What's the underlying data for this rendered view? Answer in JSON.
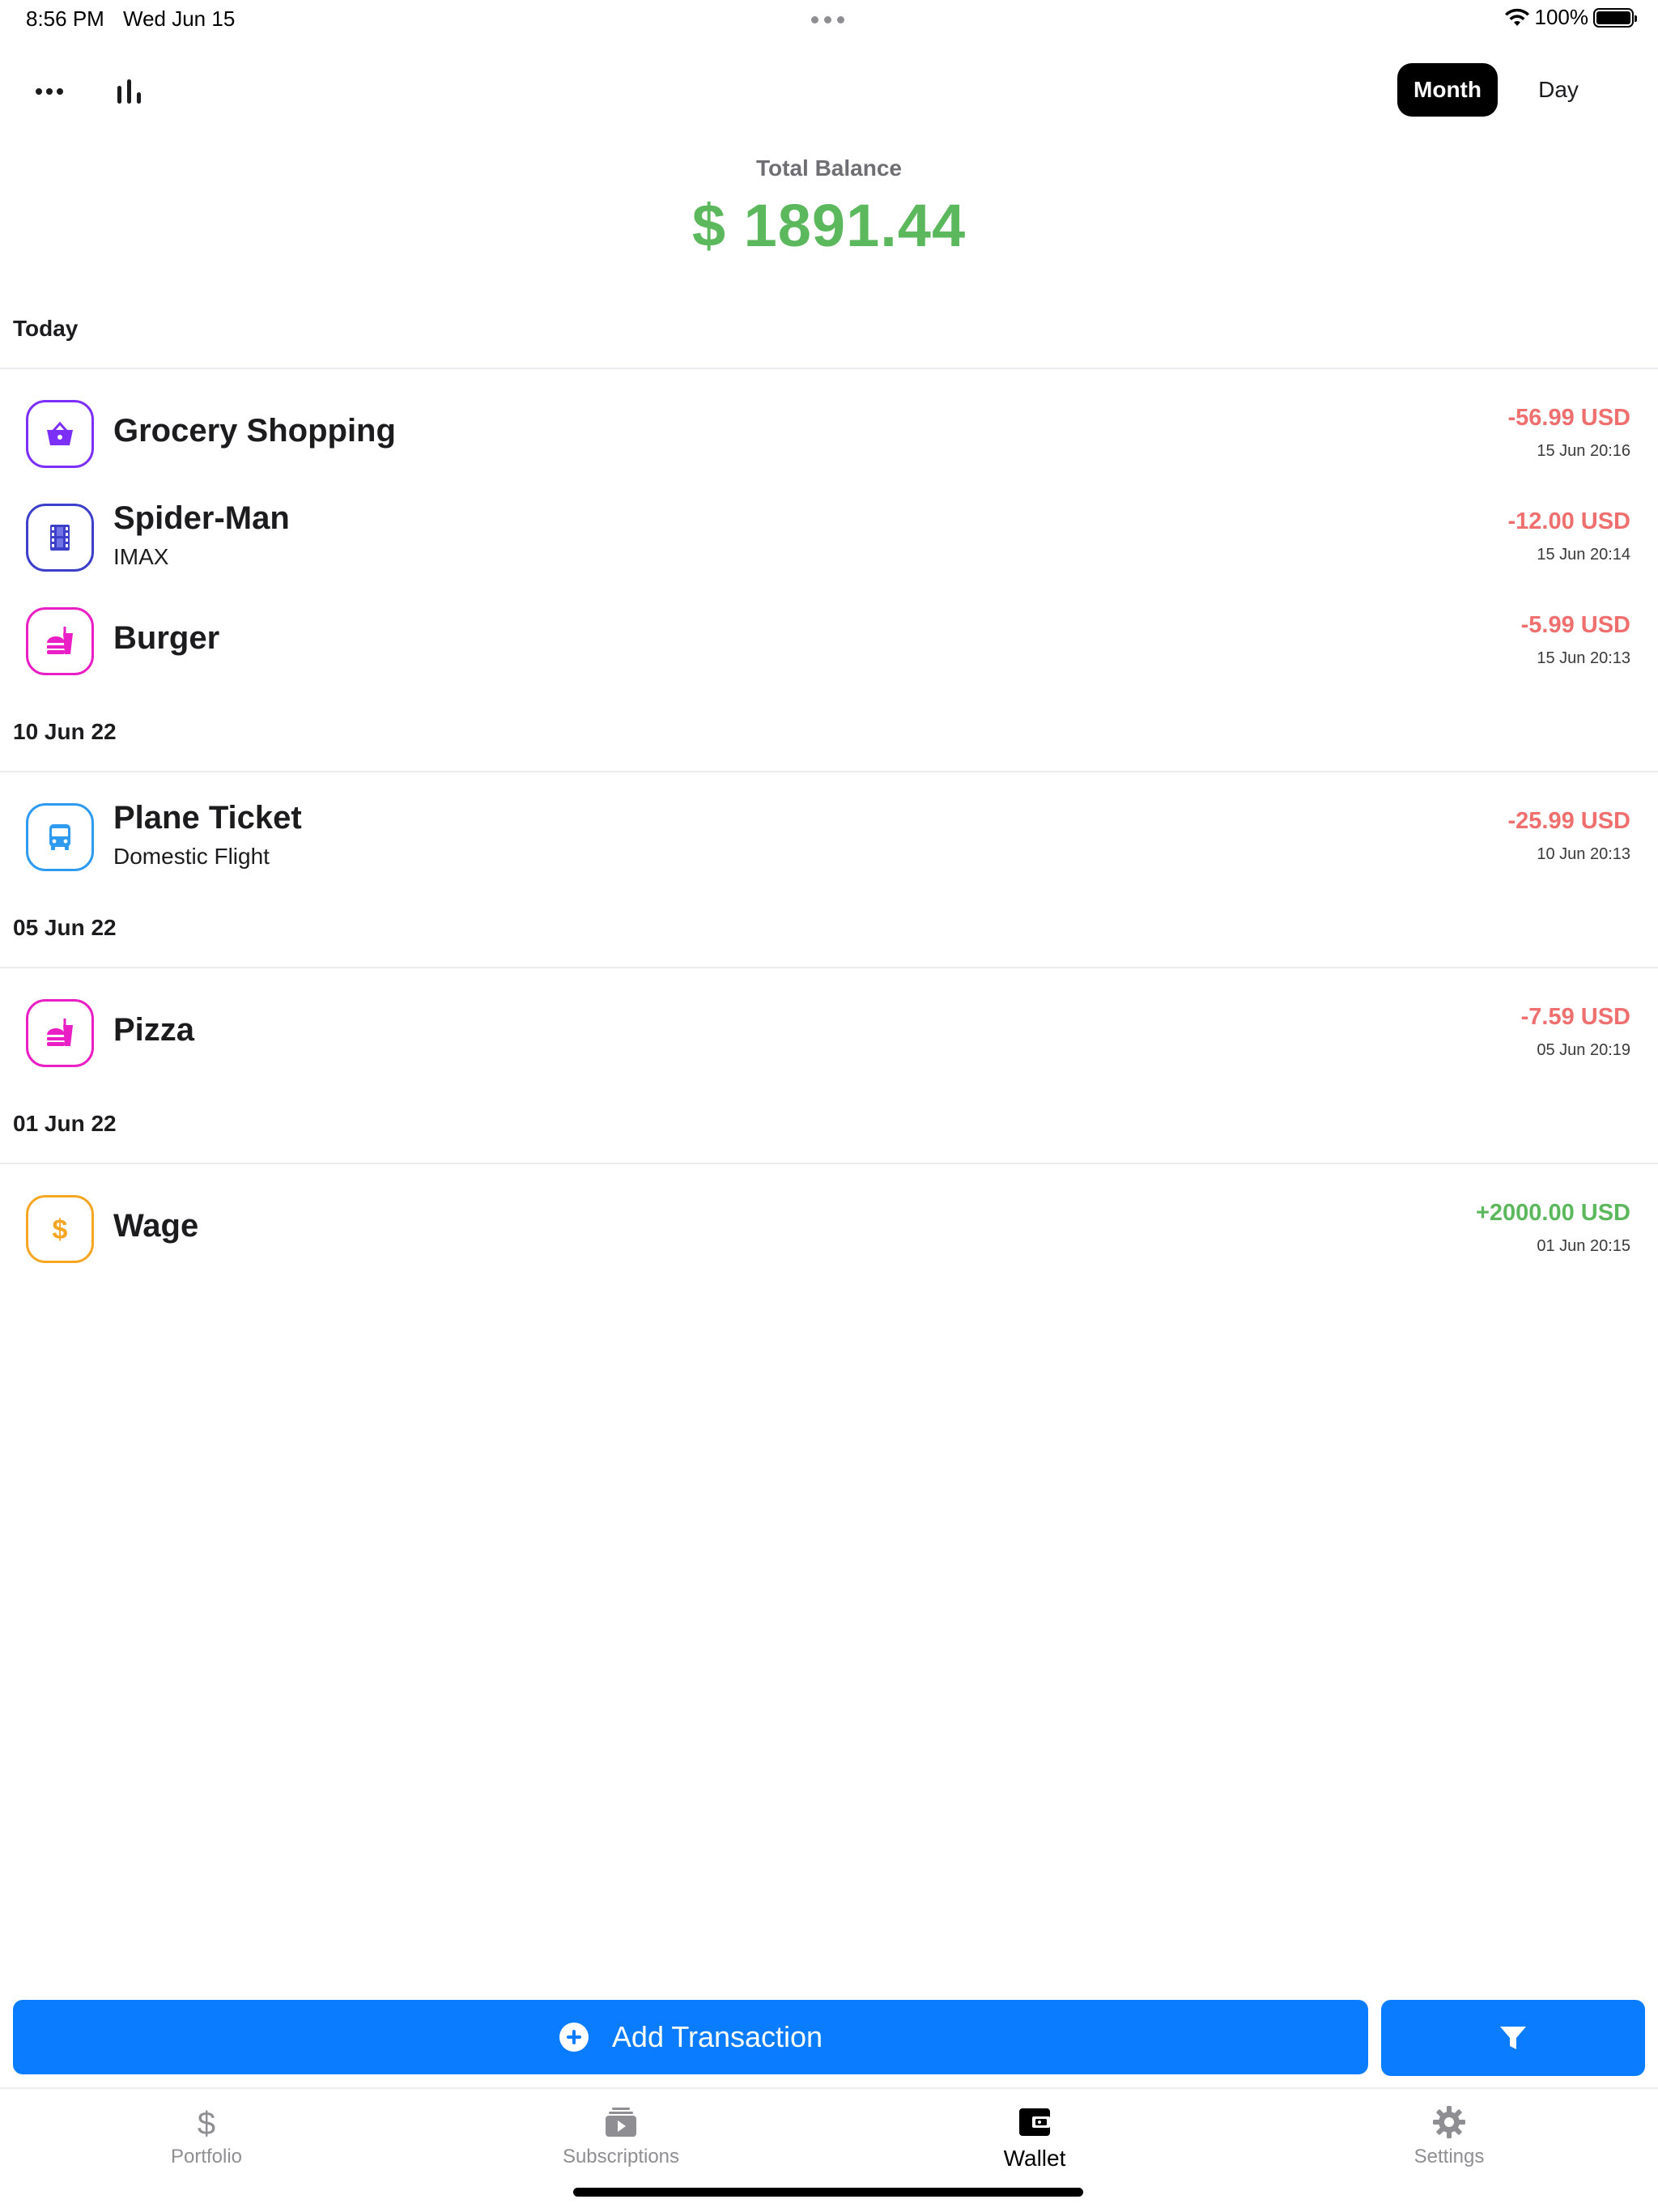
{
  "status_bar": {
    "time": "8:56 PM",
    "date": "Wed Jun 15",
    "battery": "100%"
  },
  "toolbar": {
    "more_icon": "ellipsis-icon",
    "chart_icon": "bar-chart-icon",
    "segments": [
      "Month",
      "Day"
    ],
    "selected_segment": "Month"
  },
  "balance": {
    "label": "Total Balance",
    "value": "$ 1891.44",
    "color": "#5cb85c"
  },
  "sections": [
    {
      "header": "Today",
      "transactions": [
        {
          "title": "Grocery Shopping",
          "subtitle": "",
          "amount": "-56.99 USD",
          "time": "15 Jun 20:16",
          "icon": "basket-icon",
          "icon_color": "#7b2ff7"
        },
        {
          "title": "Spider-Man",
          "subtitle": "IMAX",
          "amount": "-12.00 USD",
          "time": "15 Jun 20:14",
          "icon": "film-icon",
          "icon_color": "#3b3fc9"
        },
        {
          "title": "Burger",
          "subtitle": "",
          "amount": "-5.99 USD",
          "time": "15 Jun 20:13",
          "icon": "fastfood-icon",
          "icon_color": "#e91ec4"
        }
      ]
    },
    {
      "header": "10 Jun 22",
      "transactions": [
        {
          "title": "Plane Ticket",
          "subtitle": "Domestic Flight",
          "amount": "-25.99 USD",
          "time": "10 Jun 20:13",
          "icon": "bus-icon",
          "icon_color": "#2e9bf0"
        }
      ]
    },
    {
      "header": "05 Jun 22",
      "transactions": [
        {
          "title": "Pizza",
          "subtitle": "",
          "amount": "-7.59 USD",
          "time": "05 Jun 20:19",
          "icon": "fastfood-icon",
          "icon_color": "#e91ec4"
        }
      ]
    },
    {
      "header": "01 Jun 22",
      "transactions": [
        {
          "title": "Wage",
          "subtitle": "",
          "amount": "+2000.00 USD",
          "time": "01 Jun 20:15",
          "icon": "dollar-icon",
          "icon_color": "#f5a623"
        }
      ]
    }
  ],
  "colors": {
    "expense": "#ef6f6f",
    "income": "#5cb85c",
    "accent": "#0a7cff"
  },
  "actions": {
    "add_label": "Add Transaction",
    "add_icon": "plus-circle-icon",
    "filter_icon": "filter-icon"
  },
  "tabs": [
    {
      "label": "Portfolio",
      "icon": "dollar-icon",
      "active": false
    },
    {
      "label": "Subscriptions",
      "icon": "subscriptions-icon",
      "active": false
    },
    {
      "label": "Wallet",
      "icon": "wallet-icon",
      "active": true
    },
    {
      "label": "Settings",
      "icon": "gear-icon",
      "active": false
    }
  ]
}
